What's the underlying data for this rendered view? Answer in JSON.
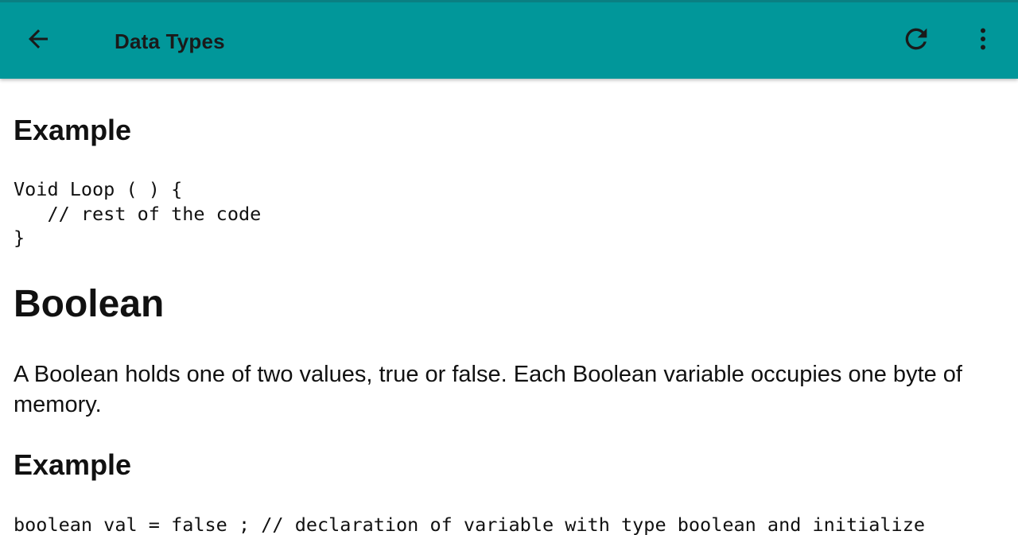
{
  "appbar": {
    "title": "Data Types",
    "background_color": "#01979a",
    "back_icon": "arrow-left-icon",
    "refresh_icon": "refresh-icon",
    "more_icon": "more-vertical-icon"
  },
  "article": {
    "cut_text": "•",
    "example_heading_1": "Example",
    "code_1": "Void Loop ( ) {\n   // rest of the code\n}",
    "section_heading": "Boolean",
    "paragraph": "A Boolean holds one of two values, true or false. Each Boolean variable occupies one byte of memory.",
    "example_heading_2": "Example",
    "code_2": "boolean val = false ; // declaration of variable with type boolean and initialize"
  }
}
